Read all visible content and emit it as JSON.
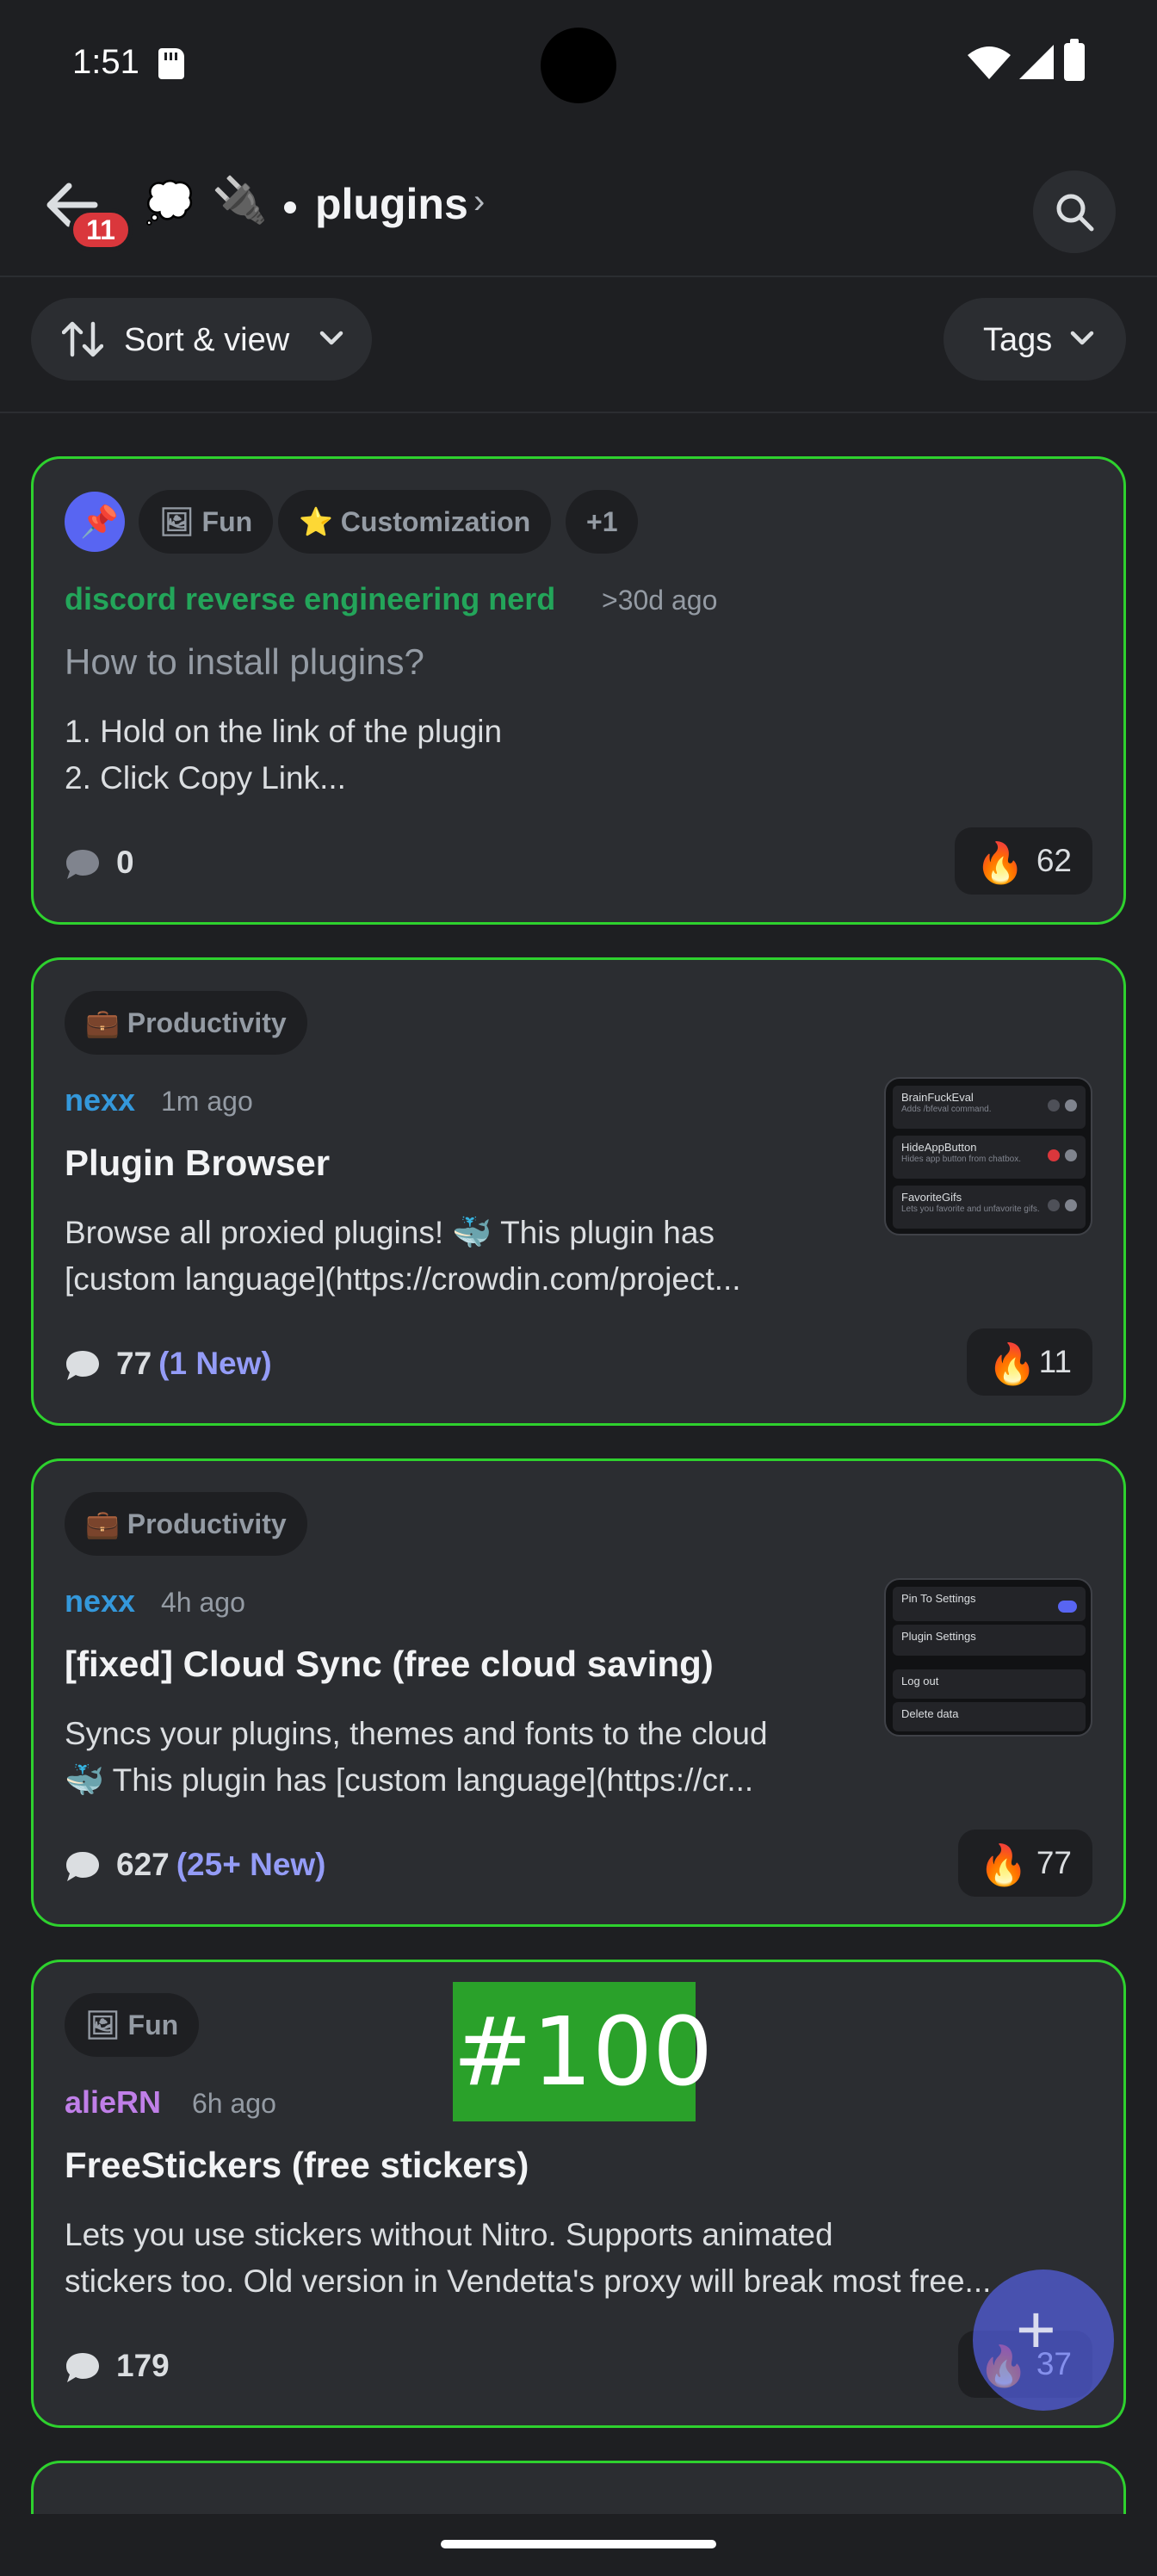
{
  "status_bar": {
    "time": "1:51"
  },
  "header": {
    "back_badge": "11",
    "forum_icon": "💭",
    "channel_icon": "🔌",
    "channel_name": "plugins",
    "chevron": "›"
  },
  "filters": {
    "sort_label": "Sort & view",
    "tags_label": "Tags"
  },
  "posts": [
    {
      "tags": [
        {
          "icon": "🖼",
          "label": "Fun"
        },
        {
          "icon": "⭐",
          "label": "Customization"
        },
        {
          "icon": "",
          "label": "+1"
        }
      ],
      "author": "discord reverse engineering nerd",
      "author_color": "#23a55a",
      "age": ">30d ago",
      "title": "How to install plugins?",
      "body_lines": [
        "1.  Hold on the link of the plugin",
        "  2.  Click Copy Link..."
      ],
      "comments": "0",
      "comments_new": "",
      "reaction_emoji": "🔥",
      "reaction_count": "62"
    },
    {
      "tags": [
        {
          "icon": "💼",
          "label": "Productivity"
        }
      ],
      "author": "nexx",
      "author_color": "#3498db",
      "age": "1m ago",
      "title": "Plugin Browser",
      "body_lines": [
        "Browse all proxied plugins!  🐳 This plugin has",
        "[custom language](https://crowdin.com/project..."
      ],
      "comments": "77",
      "comments_new": "(1 New)",
      "reaction_emoji": "🔥",
      "reaction_count": "11",
      "thumb_rows": [
        {
          "title": "BrainFuckEval",
          "sub": "Adds /bfeval command."
        },
        {
          "title": "HideAppButton",
          "sub": "Hides app button from chatbox."
        },
        {
          "title": "FavoriteGifs",
          "sub": "Lets you favorite and unfavorite gifs."
        }
      ]
    },
    {
      "tags": [
        {
          "icon": "💼",
          "label": "Productivity"
        }
      ],
      "author": "nexx",
      "author_color": "#3498db",
      "age": "4h ago",
      "title": "[fixed] Cloud Sync (free cloud saving)",
      "body_lines": [
        "Syncs your plugins, themes and fonts to the cloud",
        "🐳 This plugin has [custom language](https://cr..."
      ],
      "comments": "627",
      "comments_new": "(25+ New)",
      "reaction_emoji": "🔥",
      "reaction_count": "77",
      "thumb_rows": [
        {
          "title": "Pin To Settings",
          "sub": ""
        },
        {
          "title": "Plugin Settings",
          "sub": ""
        },
        {
          "title": "Log out",
          "sub": ""
        },
        {
          "title": "Delete data",
          "sub": ""
        }
      ]
    },
    {
      "tags": [
        {
          "icon": "🖼",
          "label": "Fun"
        }
      ],
      "author": "alieRN",
      "author_color": "#c07fe8",
      "age": "6h ago",
      "title": "FreeStickers (free stickers)",
      "body_lines": [
        "Lets you use stickers without Nitro. Supports animated",
        "stickers too.  Old version in Vendetta's proxy will break most free..."
      ],
      "comments": "179",
      "comments_new": "",
      "reaction_emoji": "🔥",
      "reaction_count": "37"
    }
  ],
  "overlay_badge": "#100",
  "fab_label": "+"
}
